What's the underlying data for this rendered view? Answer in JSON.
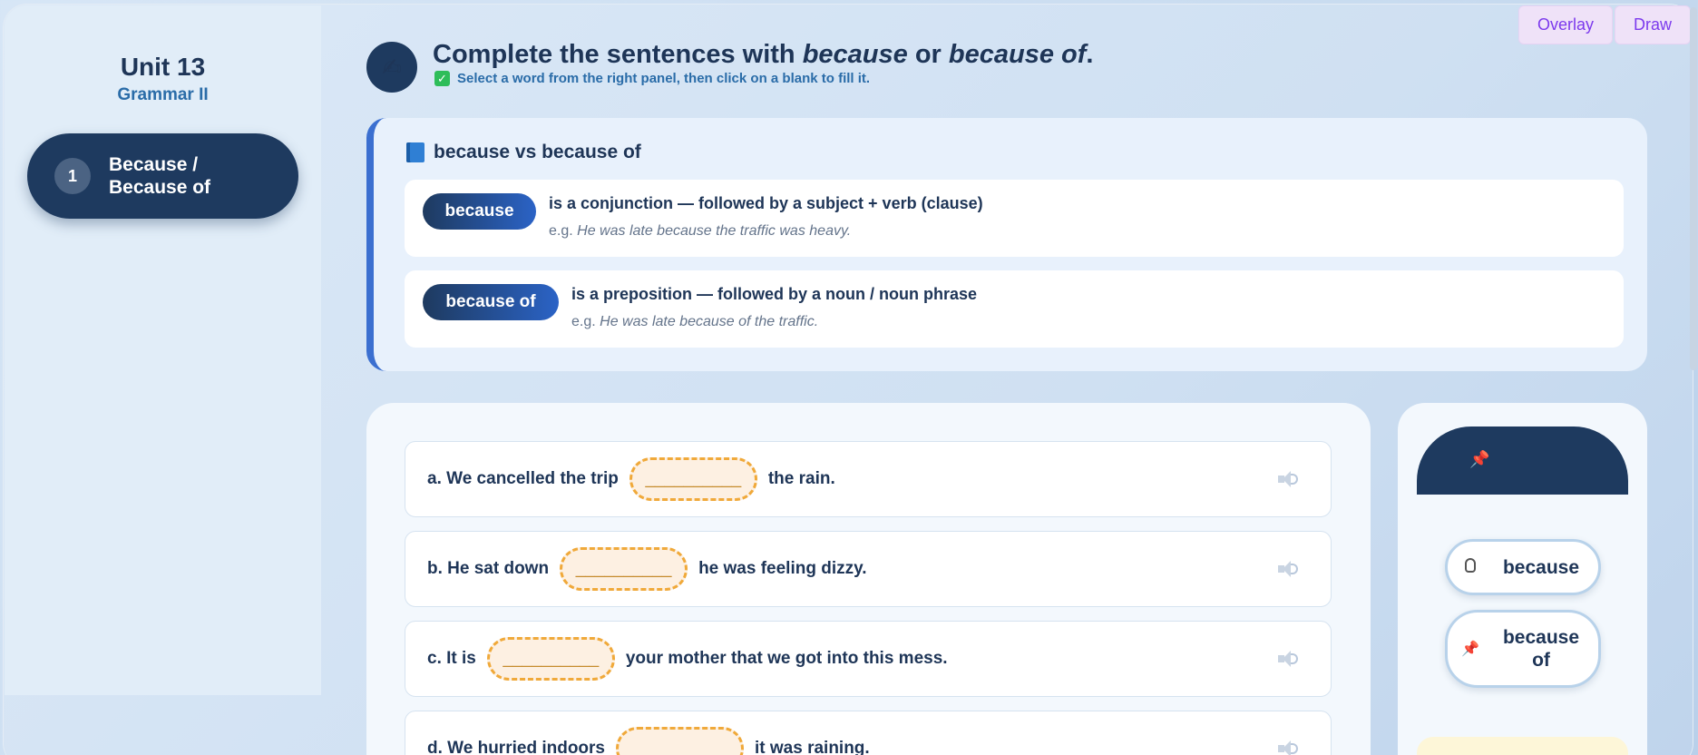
{
  "toolbar": {
    "overlay_label": "Overlay",
    "draw_label": "Draw"
  },
  "sidebar": {
    "unit_title": "Unit 13",
    "unit_subtitle": "Grammar II",
    "items": [
      {
        "number": "1",
        "label": "Because / Because of",
        "active": true
      }
    ]
  },
  "header": {
    "icon": "writing-hand-icon",
    "title_prefix": "Complete the sentences with ",
    "title_word1": "because",
    "title_middle": " or ",
    "title_word2": "because of",
    "title_suffix": ".",
    "instruction": "Select a word from the right panel, then click on a blank to fill it."
  },
  "info": {
    "title": "because vs because of",
    "rules": [
      {
        "term": "because",
        "description": "is a conjunction — followed by a subject + verb (clause)",
        "example_prefix": "e.g. ",
        "example": "He was late because the traffic was heavy."
      },
      {
        "term": "because of",
        "description": "is a preposition — followed by a noun / noun phrase",
        "example_prefix": "e.g. ",
        "example": "He was late because of the traffic."
      }
    ]
  },
  "exercise": {
    "blank_placeholder": "__________",
    "questions": [
      {
        "before": "a. We cancelled the trip",
        "after": "the rain."
      },
      {
        "before": "b. He sat down",
        "after": "he was feeling dizzy."
      },
      {
        "before": "c. It is",
        "after": "your mother that we got into this mess."
      },
      {
        "before": "d. We hurried indoors",
        "after": "it was raining."
      }
    ]
  },
  "word_bank": {
    "words": [
      {
        "label": "because",
        "icon": "pointing-hand-icon"
      },
      {
        "label": "because of",
        "icon": "pushpin-icon"
      }
    ],
    "colors": {
      "pin": "#e23a5a",
      "header": "#1e3a5f"
    }
  },
  "colors": {
    "navy": "#1e3a5f",
    "accent_blue": "#2b63c6",
    "blank_border": "#f0a93a",
    "button_purple": "#7c3aed"
  }
}
